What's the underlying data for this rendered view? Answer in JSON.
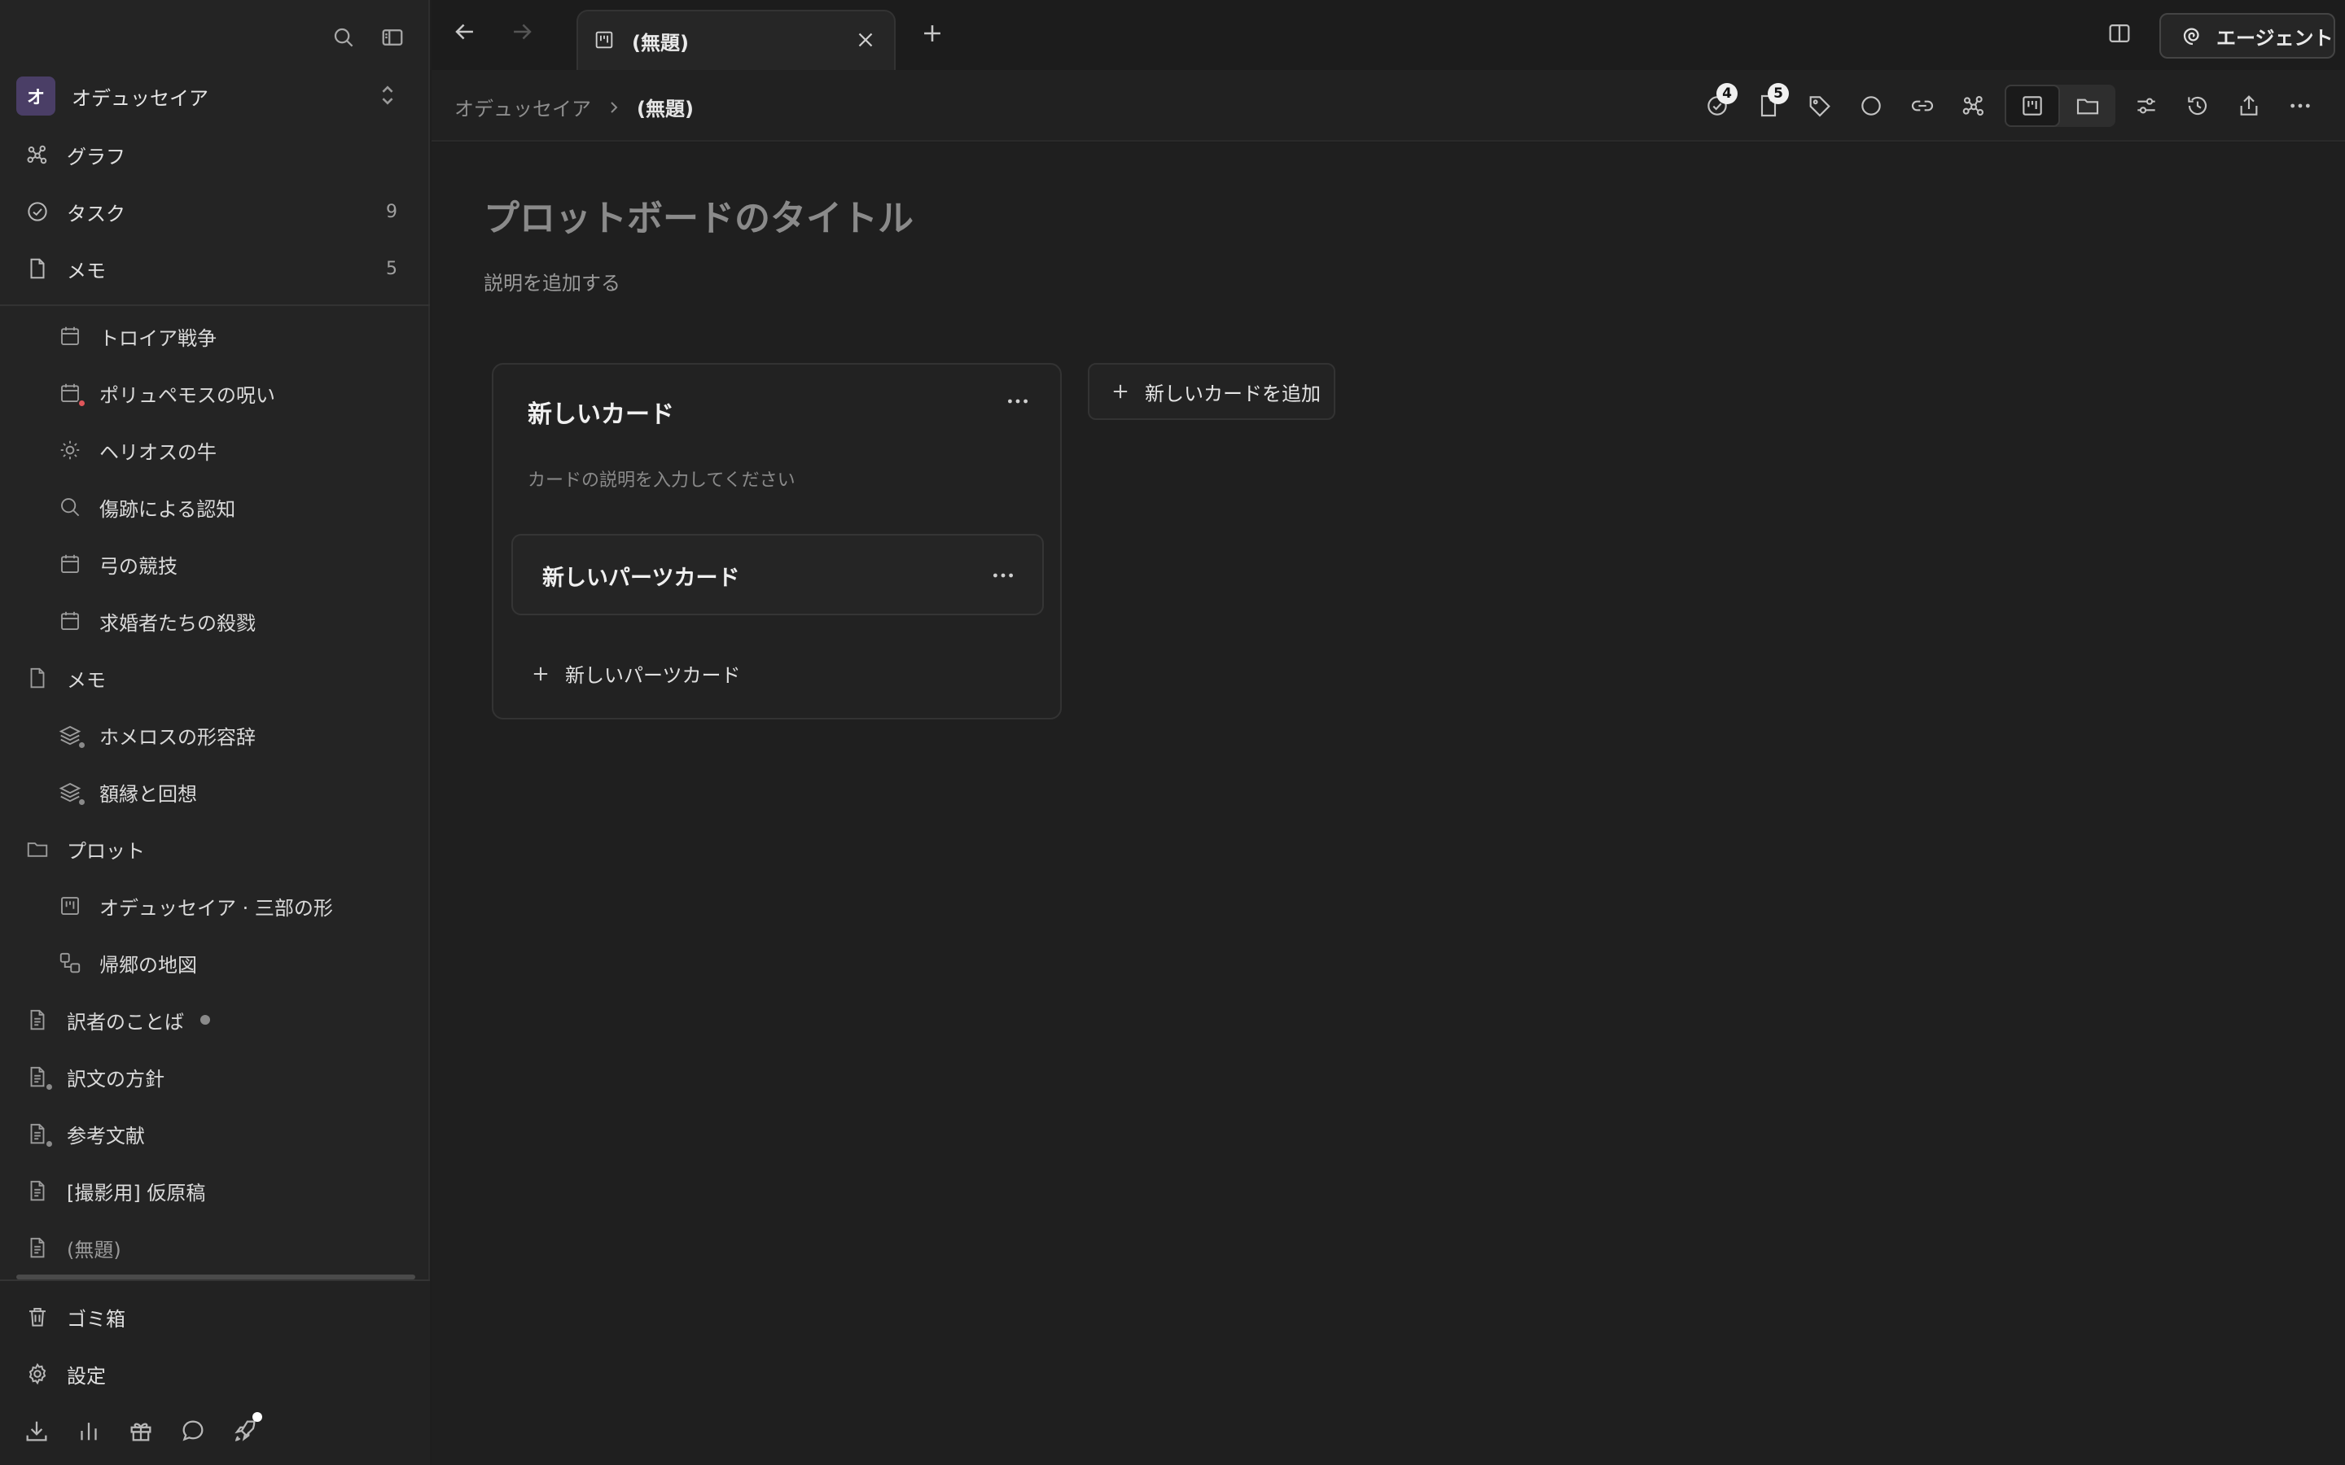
{
  "workspace": {
    "avatar": "オ",
    "name": "オデュッセイア"
  },
  "nav": [
    {
      "label": "グラフ",
      "count": ""
    },
    {
      "label": "タスク",
      "count": "9"
    },
    {
      "label": "メモ",
      "count": "5"
    }
  ],
  "tree": [
    {
      "label": "トロイア戦争",
      "icon": "calendar-icon"
    },
    {
      "label": "ポリュペモスの呪い",
      "icon": "calendar-icon"
    },
    {
      "label": "ヘリオスの牛",
      "icon": "sun-icon"
    },
    {
      "label": "傷跡による認知",
      "icon": "search-icon"
    },
    {
      "label": "弓の競技",
      "icon": "calendar-icon"
    },
    {
      "label": "求婚者たちの殺戮",
      "icon": "calendar-icon"
    },
    {
      "label": "メモ",
      "icon": "memo-icon"
    },
    {
      "label": "ホメロスの形容辞",
      "icon": "layers-icon"
    },
    {
      "label": "額縁と回想",
      "icon": "layers-icon"
    },
    {
      "label": "プロット",
      "icon": "folder-icon"
    },
    {
      "label": "オデュッセイア · 三部の形",
      "icon": "board-icon"
    },
    {
      "label": "帰郷の地図",
      "icon": "map-icon"
    },
    {
      "label": "訳者のことば",
      "icon": "document-icon"
    },
    {
      "label": "訳文の方針",
      "icon": "document-icon"
    },
    {
      "label": "参考文献",
      "icon": "document-icon"
    },
    {
      "label": "[撮影用] 仮原稿",
      "icon": "document-icon"
    },
    {
      "label": "(無題)",
      "icon": "document-icon"
    }
  ],
  "bottom": {
    "trash": "ゴミ箱",
    "settings": "設定"
  },
  "tab": {
    "title": "(無題)"
  },
  "agent": {
    "label": "エージェント"
  },
  "breadcrumb": {
    "root": "オデュッセイア",
    "current": "(無題)"
  },
  "toolbar": {
    "tasks_badge": "4",
    "notes_badge": "5"
  },
  "board": {
    "title_placeholder": "プロットボードのタイトル",
    "desc_placeholder": "説明を追加する",
    "card": {
      "title": "新しいカード",
      "desc_placeholder": "カードの説明を入力してください",
      "part_title": "新しいパーツカード",
      "add_part": "新しいパーツカード"
    },
    "add_card": "新しいカードを追加"
  }
}
